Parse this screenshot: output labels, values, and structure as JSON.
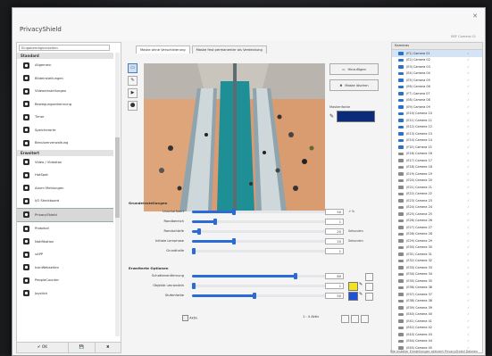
{
  "app": {
    "title": "PrivacyShield",
    "subtitle": "BSF Camera 01",
    "close": "✕"
  },
  "left": {
    "search_placeholder": "Eingabemöglichkeiten",
    "sections": [
      {
        "title": "Standard",
        "items": [
          {
            "label": "Allgemein",
            "icon": "gear-icon"
          },
          {
            "label": "Bildeinstellungen",
            "icon": "image-icon"
          },
          {
            "label": "Videoeinstellungen",
            "icon": "video-icon"
          },
          {
            "label": "Bewegungserkennung",
            "icon": "motion-icon"
          },
          {
            "label": "Timer",
            "icon": "clock-icon"
          },
          {
            "label": "Speicherorte",
            "icon": "storage-icon"
          },
          {
            "label": "Benutzerverwaltung",
            "icon": "users-icon"
          }
        ]
      },
      {
        "title": "Erweitert",
        "items": [
          {
            "label": "Video / Videoton",
            "icon": "video-icon"
          },
          {
            "label": "HotSpot",
            "icon": "monitor-icon"
          },
          {
            "label": "Alarm Meldungen",
            "icon": "alarm-icon"
          },
          {
            "label": "I/O Steckboard",
            "icon": "io-icon"
          },
          {
            "label": "PrivacyShield",
            "icon": "shield-icon",
            "selected": true
          },
          {
            "label": "Protokoll",
            "icon": "log-icon"
          },
          {
            "label": "Notifikation",
            "icon": "bell-icon"
          },
          {
            "label": "vAPP",
            "icon": "cloud-icon"
          },
          {
            "label": "IconWebseiten",
            "icon": "user-icon"
          },
          {
            "label": "PeopleCounter",
            "icon": "person-icon"
          },
          {
            "label": "Joystick",
            "icon": "joystick-icon"
          }
        ]
      }
    ],
    "buttons": {
      "ok": "OK",
      "save": "💾",
      "cancel": "✖"
    }
  },
  "center": {
    "tabs": [
      "Maske ohne Verschleierung",
      "Maske fest permanenter als Verdeckung"
    ],
    "tools": [
      "▭",
      "✎",
      "▶",
      "⬤"
    ],
    "buttons": {
      "add": "Hinzufügen",
      "delete": "Maske löschen"
    },
    "mask_color_label": "Maskenfarbe",
    "mask_color": "#0a2a7a",
    "section_titles": {
      "basic": "Grundeinstellungen",
      "advanced": "Erweiterte Optionen"
    },
    "basic_rows": [
      {
        "label": "Unscharfwert",
        "value": "50",
        "unit": "↗ %",
        "level": 0.31
      },
      {
        "label": "Randbereich",
        "value": "1",
        "unit": "",
        "level": 0.17
      },
      {
        "label": "Randschärfe",
        "value": "20",
        "unit": "Sekunden",
        "level": 0.05
      },
      {
        "label": "Initiale Lernphase",
        "value": "20",
        "unit": "Sekunden",
        "level": 0.31
      },
      {
        "label": "Grundhelle",
        "value": "1",
        "unit": "",
        "level": 0.01
      }
    ],
    "advanced_rows": [
      {
        "label": "Schattenentfernung",
        "value": "80",
        "unit": "",
        "level": 0.76,
        "color": ""
      },
      {
        "label": "Objekte umrandeln",
        "value": "1",
        "unit": "",
        "level": 0.01,
        "color": "#f2e31e"
      },
      {
        "label": "Stufenfarbe",
        "value": "50",
        "unit": "",
        "level": 0.46,
        "color": "#1d52d6"
      }
    ],
    "bottom": {
      "label": "Aktiv",
      "mode": "1 : 4 Aktiv"
    }
  },
  "right": {
    "header": "Kameras",
    "cameras": [
      {
        "name": "(F1) Camera 01",
        "active": true,
        "selected": true
      },
      {
        "name": "(E2) Camera 02",
        "active": true
      },
      {
        "name": "(E3) Camera 03",
        "active": true
      },
      {
        "name": "(E4) Camera 04",
        "active": true
      },
      {
        "name": "(E5) Camera 05",
        "active": true
      },
      {
        "name": "(E6) Camera 06",
        "active": true
      },
      {
        "name": "(F7) Camera 07",
        "active": true
      },
      {
        "name": "(E8) Camera 08",
        "active": true
      },
      {
        "name": "(E9) Camera 09",
        "active": true
      },
      {
        "name": "(E10) Camera 10",
        "active": true
      },
      {
        "name": "(E11) Camera 11",
        "active": true
      },
      {
        "name": "(E12) Camera 12",
        "active": true
      },
      {
        "name": "(E13) Camera 13",
        "active": true
      },
      {
        "name": "(E14) Camera 14",
        "active": true
      },
      {
        "name": "(F15) Camera 15",
        "active": true
      },
      {
        "name": "(E16) Camera 16",
        "active": false
      },
      {
        "name": "(E17) Camera 17",
        "active": false
      },
      {
        "name": "(E18) Camera 18",
        "active": false
      },
      {
        "name": "(E19) Camera 19",
        "active": false
      },
      {
        "name": "(E20) Camera 20",
        "active": false
      },
      {
        "name": "(E21) Camera 21",
        "active": false
      },
      {
        "name": "(E22) Camera 22",
        "active": false
      },
      {
        "name": "(E23) Camera 23",
        "active": false
      },
      {
        "name": "(E24) Camera 24",
        "active": false
      },
      {
        "name": "(E25) Camera 25",
        "active": false
      },
      {
        "name": "(E26) Camera 26",
        "active": false
      },
      {
        "name": "(E27) Camera 27",
        "active": false
      },
      {
        "name": "(E28) Camera 28",
        "active": false
      },
      {
        "name": "(E29) Camera 29",
        "active": false
      },
      {
        "name": "(E30) Camera 30",
        "active": false
      },
      {
        "name": "(E31) Camera 31",
        "active": false
      },
      {
        "name": "(E32) Camera 32",
        "active": false
      },
      {
        "name": "(E33) Camera 33",
        "active": false
      },
      {
        "name": "(E34) Camera 34",
        "active": false
      },
      {
        "name": "(E35) Camera 35",
        "active": false
      },
      {
        "name": "(E36) Camera 36",
        "active": false
      },
      {
        "name": "(E37) Camera 37",
        "active": false
      },
      {
        "name": "(E38) Camera 38",
        "active": false
      },
      {
        "name": "(E39) Camera 39",
        "active": false
      },
      {
        "name": "(E40) Camera 40",
        "active": false
      },
      {
        "name": "(E41) Camera 41",
        "active": false
      },
      {
        "name": "(E42) Camera 42",
        "active": false
      },
      {
        "name": "(E43) Camera 43",
        "active": false
      },
      {
        "name": "(E44) Camera 44",
        "active": false
      },
      {
        "name": "(E45) Camera 45",
        "active": false
      }
    ],
    "footer": "Die Installer Einstellungen aktiviert PrivacyShield Dateien"
  }
}
